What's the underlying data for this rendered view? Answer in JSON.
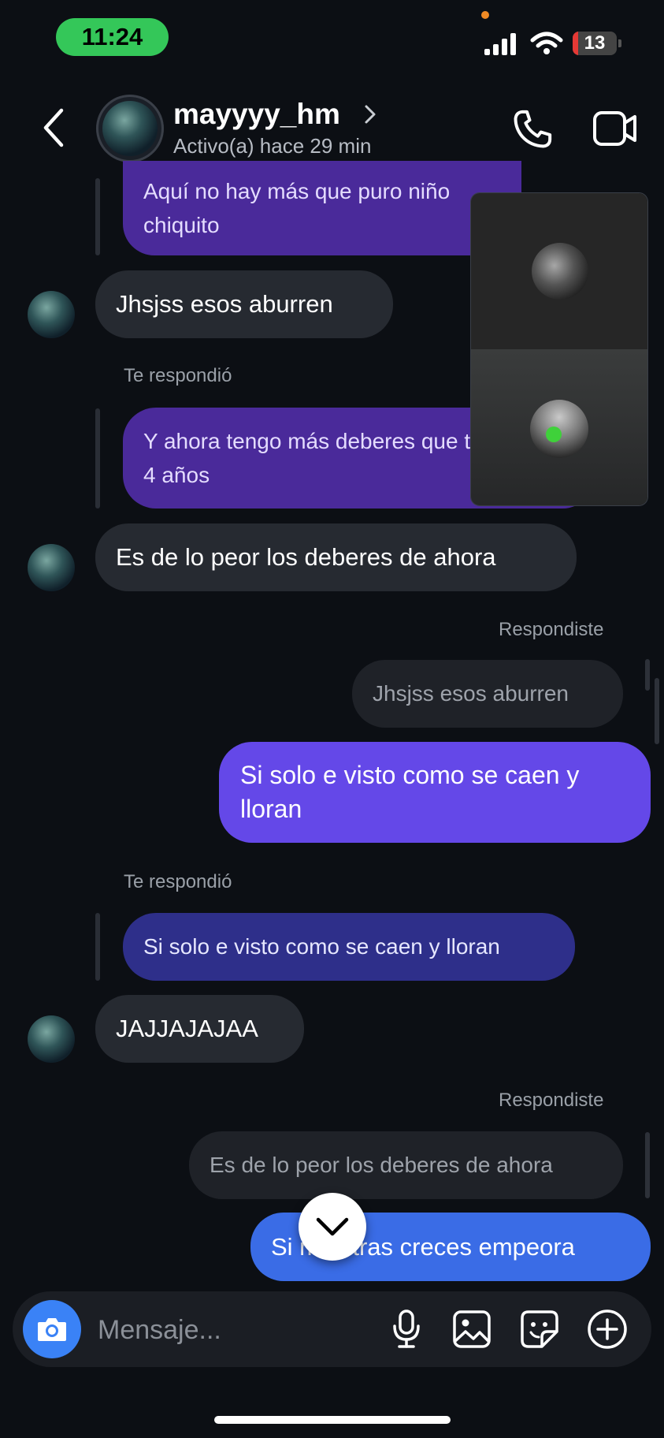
{
  "status_bar": {
    "time": "11:24",
    "battery": "13",
    "battery_level": 0.13
  },
  "header": {
    "username": "mayyyy_hm",
    "status": "Activo(a) hace 29 min"
  },
  "messages": {
    "m1": "Aquí no hay más que puro niño chiquito",
    "m2": "Jhsjss esos aburren",
    "m3_meta": "Te respondió",
    "m3": "Y ahora tengo más deberes que tenía hace 4 años",
    "m4": "Es de lo peor los deberes de ahora",
    "m5_meta": "Respondiste",
    "m5_quote": "Jhsjss esos aburren",
    "m6": "Si solo e visto como se caen y lloran",
    "m7_meta": "Te respondió",
    "m7_quote": "Si solo e visto como se caen y lloran",
    "m8": "JAJJAJAJAA",
    "m9_meta": "Respondiste",
    "m9_quote": "Es de lo peor los deberes de ahora",
    "m10": "Si mientras creces empeora"
  },
  "composer": {
    "placeholder": "Mensaje..."
  },
  "colors": {
    "purple": "#4a2a9a",
    "violet": "#6448e8",
    "blue": "#3a6ce6",
    "navy": "#2e2f8a"
  }
}
